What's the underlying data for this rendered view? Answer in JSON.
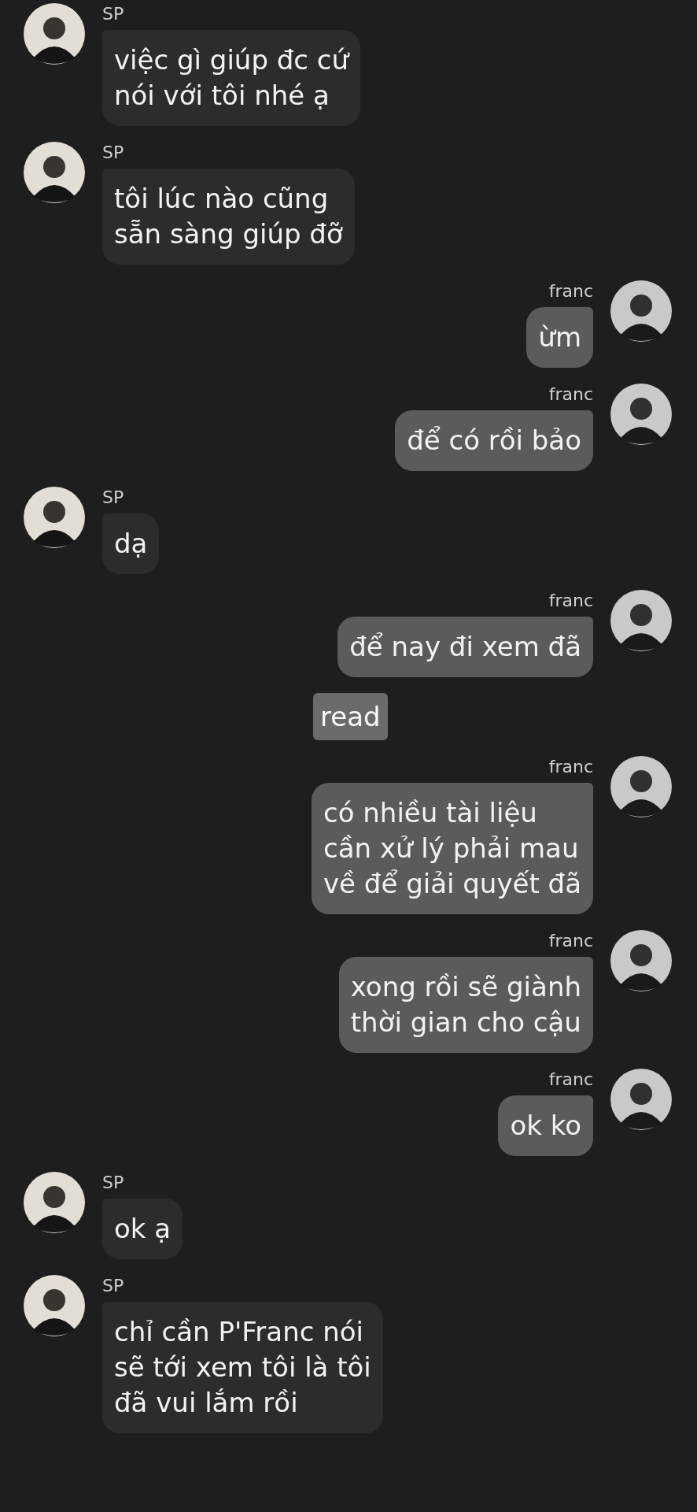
{
  "messages": [
    {
      "kind": "incoming",
      "name": "SP",
      "text": "việc gì giúp đc cứ\nnói với tôi nhé ạ"
    },
    {
      "kind": "incoming",
      "name": "SP",
      "text": "tôi lúc nào cũng\nsẵn sàng giúp đỡ"
    },
    {
      "kind": "outgoing",
      "name": "franc",
      "text": "ừm"
    },
    {
      "kind": "outgoing",
      "name": "franc",
      "text": "để có rồi bảo"
    },
    {
      "kind": "incoming",
      "name": "SP",
      "text": "dạ"
    },
    {
      "kind": "outgoing",
      "name": "franc",
      "text": "để nay đi xem đã"
    },
    {
      "kind": "status",
      "text": "read"
    },
    {
      "kind": "outgoing",
      "name": "franc",
      "text": "có nhiều tài liệu\ncần xử lý phải mau\nvề để giải quyết đã"
    },
    {
      "kind": "outgoing",
      "name": "franc",
      "text": "xong rồi sẽ giành\nthời gian cho cậu"
    },
    {
      "kind": "outgoing",
      "name": "franc",
      "text": "ok ko"
    },
    {
      "kind": "incoming",
      "name": "SP",
      "text": "ok ạ"
    },
    {
      "kind": "incoming",
      "name": "SP",
      "text": "chỉ cần P'Franc nói\nsẽ tới xem tôi là tôi\nđã vui lắm rồi"
    }
  ]
}
